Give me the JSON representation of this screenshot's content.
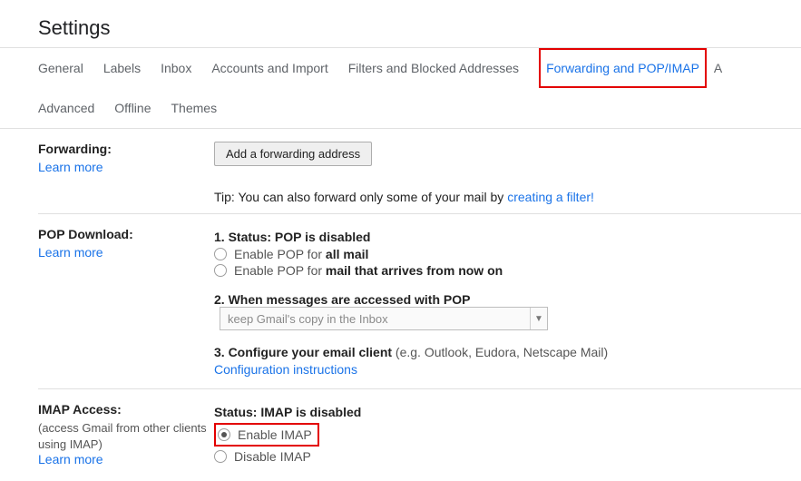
{
  "page_title": "Settings",
  "tabs": {
    "general": "General",
    "labels": "Labels",
    "inbox": "Inbox",
    "accounts": "Accounts and Import",
    "filters": "Filters and Blocked Addresses",
    "forwarding": "Forwarding and POP/IMAP",
    "advanced": "Advanced",
    "offline": "Offline",
    "themes": "Themes",
    "cutoff": "A"
  },
  "forwarding": {
    "heading": "Forwarding:",
    "learn": "Learn more",
    "button": "Add a forwarding address",
    "tip_prefix": "Tip: You can also forward only some of your mail by ",
    "tip_link": "creating a filter!"
  },
  "pop": {
    "heading": "POP Download:",
    "learn": "Learn more",
    "status_prefix": "1. Status: ",
    "status_value": "POP is disabled",
    "enable_all_prefix": "Enable POP for ",
    "enable_all_bold": "all mail",
    "enable_new_prefix": "Enable POP for ",
    "enable_new_bold": "mail that arrives from now on",
    "accessed_label": "2. When messages are accessed with POP",
    "accessed_select": "keep Gmail's copy in the Inbox",
    "configure_bold": "3. Configure your email client",
    "configure_rest": " (e.g. Outlook, Eudora, Netscape Mail)",
    "config_link": "Configuration instructions"
  },
  "imap": {
    "heading": "IMAP Access:",
    "sub": "(access Gmail from other clients using IMAP)",
    "learn": "Learn more",
    "status_prefix": "Status: ",
    "status_value": "IMAP is disabled",
    "enable": "Enable IMAP",
    "disable": "Disable IMAP"
  }
}
